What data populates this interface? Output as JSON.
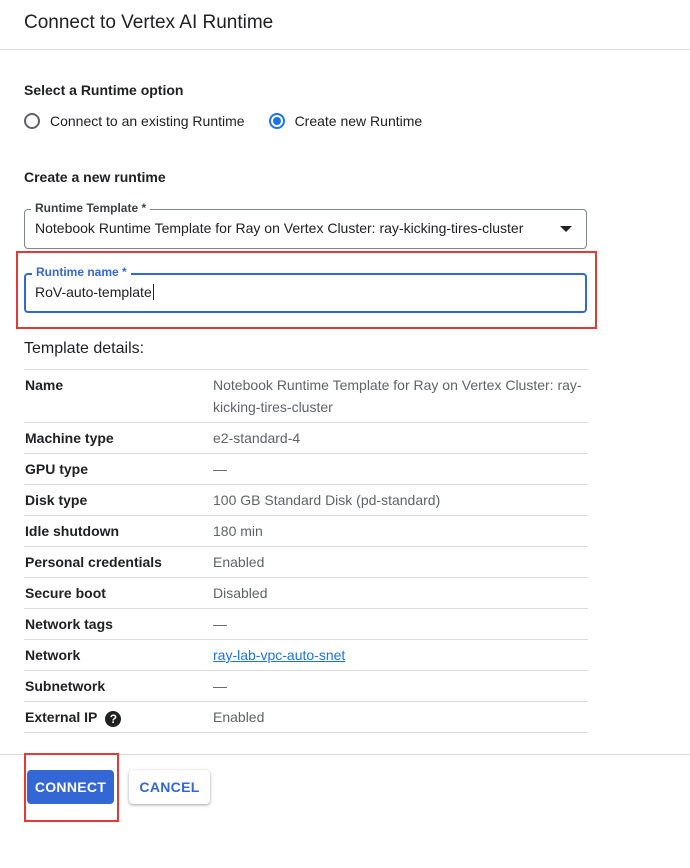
{
  "dialog": {
    "title": "Connect to Vertex AI Runtime"
  },
  "runtime_option": {
    "label": "Select a Runtime option",
    "options": [
      {
        "label": "Connect to an existing Runtime",
        "selected": false
      },
      {
        "label": "Create new Runtime",
        "selected": true
      }
    ]
  },
  "create_section": {
    "label": "Create a new runtime"
  },
  "runtime_template": {
    "label": "Runtime Template *",
    "value": "Notebook Runtime Template for Ray on Vertex Cluster: ray-kicking-tires-cluster"
  },
  "runtime_name": {
    "label": "Runtime name *",
    "value": "RoV-auto-template"
  },
  "template_details": {
    "heading": "Template details:",
    "rows": [
      {
        "key": "Name",
        "value": "Notebook Runtime Template for Ray on Vertex Cluster: ray-kicking-tires-cluster"
      },
      {
        "key": "Machine type",
        "value": "e2-standard-4"
      },
      {
        "key": "GPU type",
        "value": "—"
      },
      {
        "key": "Disk type",
        "value": "100 GB Standard Disk (pd-standard)"
      },
      {
        "key": "Idle shutdown",
        "value": "180 min"
      },
      {
        "key": "Personal credentials",
        "value": "Enabled"
      },
      {
        "key": "Secure boot",
        "value": "Disabled"
      },
      {
        "key": "Network tags",
        "value": "—"
      },
      {
        "key": "Network",
        "value": "ray-lab-vpc-auto-snet"
      },
      {
        "key": "Subnetwork",
        "value": "—"
      },
      {
        "key": "External IP",
        "value": "Enabled"
      }
    ],
    "help_icon": "help-circle-icon"
  },
  "buttons": {
    "connect": "CONNECT",
    "cancel": "CANCEL"
  },
  "colors": {
    "accent": "#3367d6",
    "highlight": "#e53935"
  }
}
